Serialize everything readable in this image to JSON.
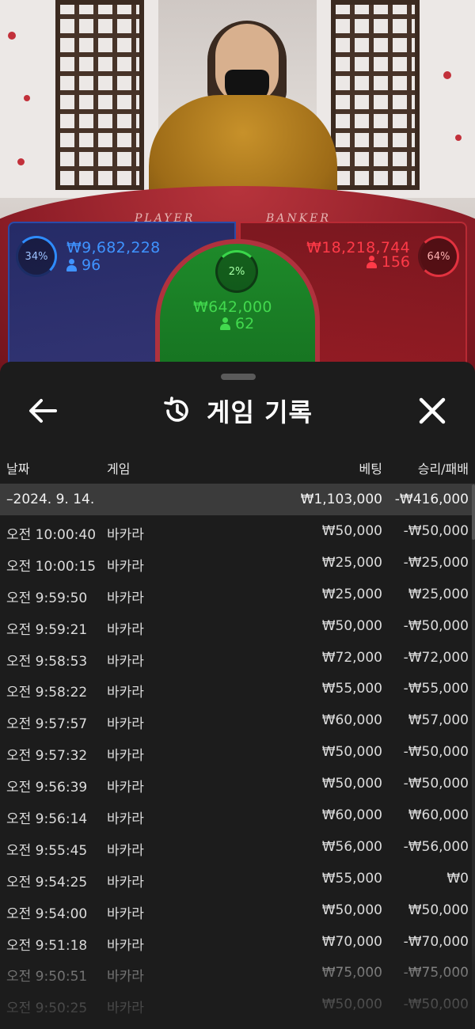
{
  "stream": {
    "felt_labels": {
      "player": "PLAYER",
      "banker": "BANKER"
    },
    "player": {
      "percent": "34%",
      "amount": "₩9,682,228",
      "count": "96"
    },
    "banker": {
      "percent": "64%",
      "amount": "₩18,218,744",
      "count": "156"
    },
    "tie": {
      "percent": "2%",
      "amount": "₩642,000",
      "count": "62"
    },
    "colors": {
      "player": "#3f93ff",
      "banker": "#ff3a48",
      "tie": "#42d94e"
    }
  },
  "sheet": {
    "title": "게임 기록",
    "title_icon": "history-icon",
    "back_icon": "arrow-left-icon",
    "close_icon": "close-icon",
    "columns": {
      "date": "날짜",
      "game": "게임",
      "bet": "베팅",
      "result": "승리/패배"
    },
    "date_group": {
      "label": "–2024. 9. 14.",
      "bet_total": "₩1,103,000",
      "result_total": "-₩416,000"
    },
    "rows": [
      {
        "time": "오전 10:00:40",
        "game": "바카라",
        "bet": "₩50,000",
        "result": "-₩50,000"
      },
      {
        "time": "오전 10:00:15",
        "game": "바카라",
        "bet": "₩25,000",
        "result": "-₩25,000"
      },
      {
        "time": "오전 9:59:50",
        "game": "바카라",
        "bet": "₩25,000",
        "result": "₩25,000"
      },
      {
        "time": "오전 9:59:21",
        "game": "바카라",
        "bet": "₩50,000",
        "result": "-₩50,000"
      },
      {
        "time": "오전 9:58:53",
        "game": "바카라",
        "bet": "₩72,000",
        "result": "-₩72,000"
      },
      {
        "time": "오전 9:58:22",
        "game": "바카라",
        "bet": "₩55,000",
        "result": "-₩55,000"
      },
      {
        "time": "오전 9:57:57",
        "game": "바카라",
        "bet": "₩60,000",
        "result": "₩57,000"
      },
      {
        "time": "오전 9:57:32",
        "game": "바카라",
        "bet": "₩50,000",
        "result": "-₩50,000"
      },
      {
        "time": "오전 9:56:39",
        "game": "바카라",
        "bet": "₩50,000",
        "result": "-₩50,000"
      },
      {
        "time": "오전 9:56:14",
        "game": "바카라",
        "bet": "₩60,000",
        "result": "₩60,000"
      },
      {
        "time": "오전 9:55:45",
        "game": "바카라",
        "bet": "₩56,000",
        "result": "-₩56,000"
      },
      {
        "time": "오전 9:54:25",
        "game": "바카라",
        "bet": "₩55,000",
        "result": "₩0"
      },
      {
        "time": "오전 9:54:00",
        "game": "바카라",
        "bet": "₩50,000",
        "result": "₩50,000"
      },
      {
        "time": "오전 9:51:18",
        "game": "바카라",
        "bet": "₩70,000",
        "result": "-₩70,000"
      },
      {
        "time": "오전 9:50:51",
        "game": "바카라",
        "bet": "₩75,000",
        "result": "-₩75,000"
      },
      {
        "time": "오전 9:50:25",
        "game": "바카라",
        "bet": "₩50,000",
        "result": "-₩50,000"
      }
    ]
  }
}
